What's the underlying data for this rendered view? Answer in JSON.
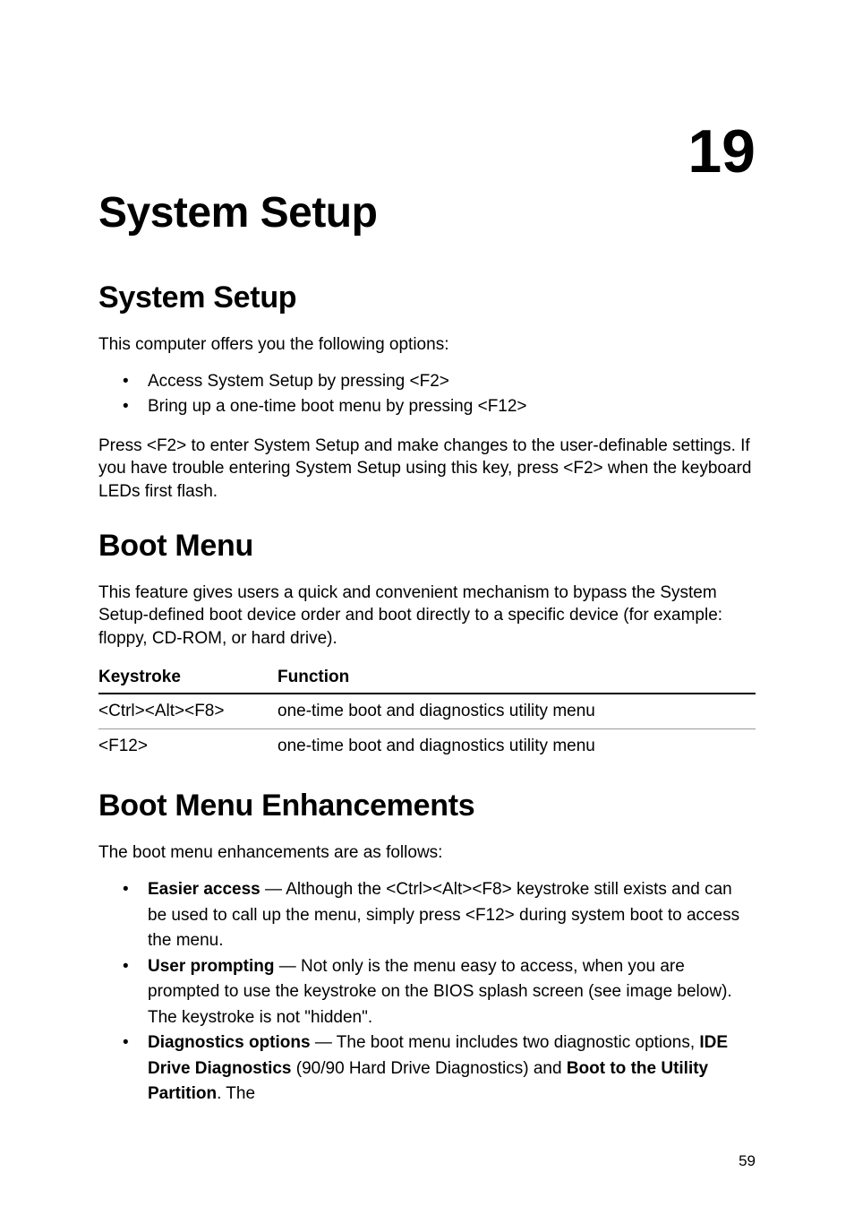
{
  "chapter_number": "19",
  "chapter_title": "System Setup",
  "sections": {
    "system_setup": {
      "title": "System Setup",
      "intro": "This computer offers you the following options:",
      "bullets": [
        "Access System Setup by pressing <F2>",
        "Bring up a one-time boot menu by pressing <F12>"
      ],
      "post_text": "Press <F2> to enter System Setup and make changes to the user-definable settings. If you have trouble entering System Setup using this key, press <F2> when the keyboard LEDs first flash."
    },
    "boot_menu": {
      "title": "Boot Menu",
      "intro": "This feature gives users a quick and convenient mechanism to bypass the System Setup-defined boot device order and boot directly to a specific device (for example: floppy, CD-ROM, or hard drive).",
      "table": {
        "headers": [
          "Keystroke",
          "Function"
        ],
        "rows": [
          [
            "<Ctrl><Alt><F8>",
            "one-time boot and diagnostics utility menu"
          ],
          [
            "<F12>",
            "one-time boot and diagnostics utility menu"
          ]
        ]
      }
    },
    "boot_menu_enhancements": {
      "title": "Boot Menu Enhancements",
      "intro": "The boot menu enhancements are as follows:",
      "items": [
        {
          "label": "Easier access",
          "text": " — Although the <Ctrl><Alt><F8> keystroke still exists and can be used to call up the menu, simply press <F12> during system boot to access the menu."
        },
        {
          "label": "User prompting",
          "text": " — Not only is the menu easy to access, when you are prompted to use the keystroke on the BIOS splash screen (see image below). The keystroke is not \"hidden\"."
        },
        {
          "label": "Diagnostics options",
          "text_pre": " — The boot menu includes two diagnostic options, ",
          "bold1": "IDE Drive Diagnostics",
          "text_mid": " (90/90 Hard Drive Diagnostics) and ",
          "bold2": "Boot to the Utility Partition",
          "text_post": ". The"
        }
      ]
    }
  },
  "page_number": "59"
}
